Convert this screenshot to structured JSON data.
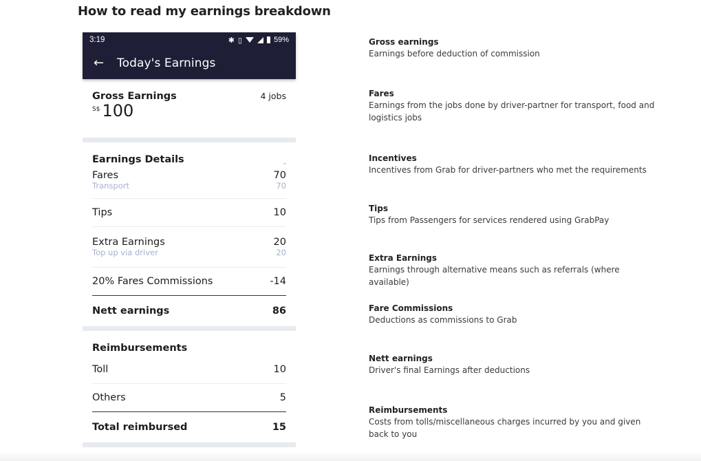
{
  "page": {
    "title": "How to read my earnings breakdown"
  },
  "phone": {
    "status_bar": {
      "time": "3:19",
      "icons": [
        "bluetooth-icon",
        "vibrate-icon",
        "wifi-icon",
        "cell-signal-icon",
        "battery-icon"
      ],
      "battery": "59%"
    },
    "app_bar": {
      "back_icon": "arrow-left-icon",
      "title": "Today's Earnings"
    },
    "gross": {
      "label": "Gross Earnings",
      "jobs": "4 jobs",
      "currency": "S$",
      "amount": "100"
    },
    "earnings_details": {
      "title": "Earnings Details",
      "toggle_icon": "chevron-up-icon",
      "rows": [
        {
          "label": "Fares",
          "value": "70",
          "sub_label": "Transport",
          "sub_value": "70"
        },
        {
          "label": "Tips",
          "value": "10"
        },
        {
          "label": "Extra Earnings",
          "value": "20",
          "sub_label": "Top up via driver",
          "sub_value": "20"
        },
        {
          "label": "20% Fares Commissions",
          "value": "-14"
        }
      ],
      "total": {
        "label": "Nett earnings",
        "value": "86"
      }
    },
    "reimbursements": {
      "title": "Reimbursements",
      "rows": [
        {
          "label": "Toll",
          "value": "10"
        },
        {
          "label": "Others",
          "value": "5"
        }
      ],
      "total": {
        "label": "Total reimbursed",
        "value": "15"
      }
    }
  },
  "glossary": [
    {
      "term": "Gross earnings",
      "definition": "Earnings before deduction of commission"
    },
    {
      "term": "Fares",
      "definition": "Earnings from the jobs done by driver-partner for transport, food and logistics jobs"
    },
    {
      "term": "Incentives",
      "definition": "Incentives from Grab for driver-partners who met the requirements"
    },
    {
      "term": "Tips",
      "definition": "Tips from Passengers for services rendered using GrabPay"
    },
    {
      "term": "Extra Earnings",
      "definition": "Earnings through alternative means such as referrals (where available)"
    },
    {
      "term": "Fare Commissions",
      "definition": "Deductions as commissions to Grab"
    },
    {
      "term": "Nett earnings",
      "definition": "Driver's final Earnings after deductions"
    },
    {
      "term": "Reimbursements",
      "definition": "Costs from tolls/miscellaneous charges incurred by you and given back to you"
    }
  ],
  "colors": {
    "app_bar": "#1e1e36",
    "band": "#e7ebef",
    "sub_text": "#a6b0cd"
  }
}
